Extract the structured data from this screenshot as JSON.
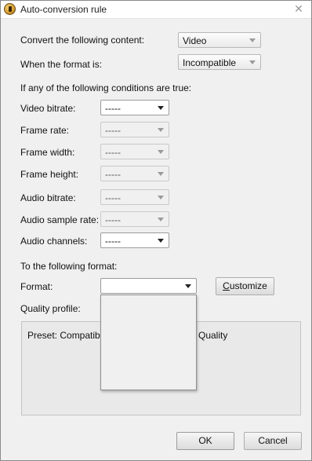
{
  "window": {
    "title": "Auto-conversion rule",
    "app_icon": "app-logo-icon",
    "close_icon": "close-icon"
  },
  "convert": {
    "label": "Convert the following content:",
    "value": "Video"
  },
  "format_is": {
    "label": "When the format is:",
    "value": "Incompatible"
  },
  "conditions_header": "If any of the following conditions are true:",
  "conditions": [
    {
      "label": "Video bitrate:",
      "value": "-----",
      "enabled": true
    },
    {
      "label": "Frame rate:",
      "value": "-----",
      "enabled": false
    },
    {
      "label": "Frame width:",
      "value": "-----",
      "enabled": false
    },
    {
      "label": "Frame height:",
      "value": "-----",
      "enabled": false
    },
    {
      "label": "Audio bitrate:",
      "value": "-----",
      "enabled": false
    },
    {
      "label": "Audio sample rate:",
      "value": "-----",
      "enabled": false
    },
    {
      "label": "Audio channels:",
      "value": "-----",
      "enabled": true
    }
  ],
  "target_header": "To the following format:",
  "format": {
    "label": "Format:",
    "value": ""
  },
  "customize_button": {
    "prefix": "C",
    "rest": "ustomize"
  },
  "quality": {
    "label": "Quality profile:",
    "preset_left": "Preset: Compatible",
    "preset_right": "Quality"
  },
  "buttons": {
    "ok": "OK",
    "cancel": "Cancel"
  }
}
